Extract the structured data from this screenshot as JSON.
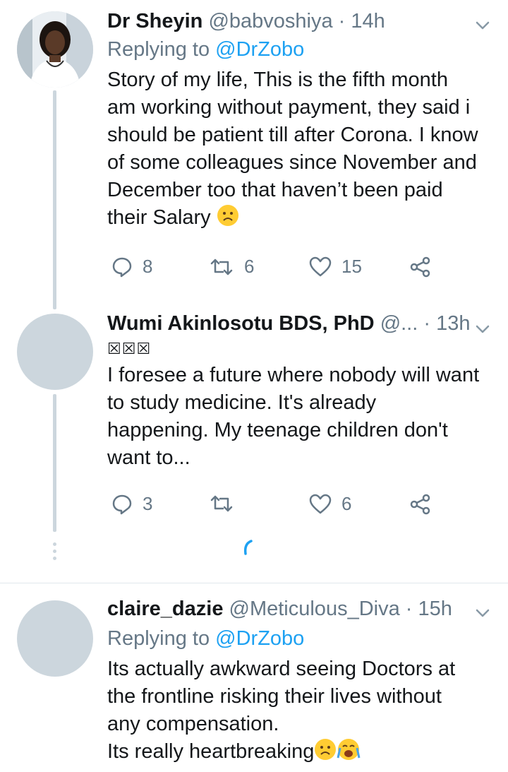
{
  "tweets": [
    {
      "name": "Dr Sheyin",
      "handle": "@babvoshiya",
      "separator": "·",
      "time": "14h",
      "replying_prefix": "Replying to",
      "replying_to": "@DrZobo",
      "text_lines": [
        "Story of my life, This is the fifth month",
        "am working without payment, they said i",
        "should be patient till after Corona. I know",
        "of some colleagues since November and",
        "December too that haven’t been paid",
        "their Salary"
      ],
      "replies": "8",
      "retweets": "6",
      "likes": "15"
    },
    {
      "name": "Wumi Akinlosotu BDS, PhD",
      "handle": "@...",
      "separator": "·",
      "time": "13h",
      "flag_text": "☒☒☒",
      "text_lines": [
        "I foresee a future where nobody will want",
        "to study medicine. It's already",
        "happening. My teenage children don't",
        "want to..."
      ],
      "replies": "3",
      "retweets": "",
      "likes": "6"
    },
    {
      "name": "claire_dazie",
      "handle": "@Meticulous_Diva",
      "separator": "·",
      "time": "15h",
      "replying_prefix": "Replying to",
      "replying_to": "@DrZobo",
      "text_lines": [
        "Its actually awkward seeing Doctors at",
        "the frontline risking their lives without",
        "any compensation.",
        "Its really heartbreaking"
      ]
    }
  ],
  "icons": {
    "reply": "reply-icon",
    "retweet": "retweet-icon",
    "like": "heart-icon",
    "share": "share-icon",
    "chevron": "chevron-down-icon",
    "loading": "loading-spinner-icon"
  },
  "colors": {
    "text": "#14171a",
    "muted": "#657786",
    "link": "#1da1f2",
    "thread_line": "#ccd6dd"
  }
}
